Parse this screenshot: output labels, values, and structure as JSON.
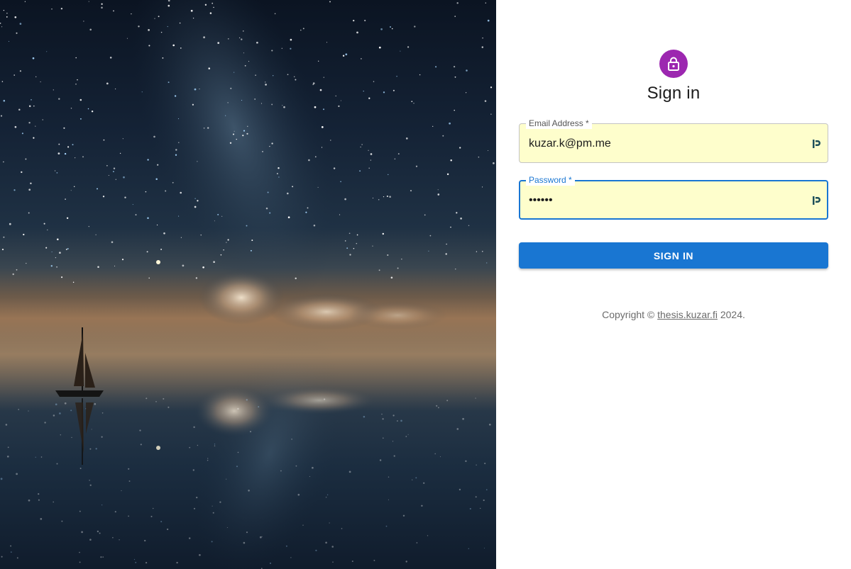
{
  "hero": {
    "image_name": "starry-night-sailboat-image"
  },
  "signin": {
    "icon": "lock-icon",
    "accent_color": "#9c27b0",
    "title": "Sign in",
    "email": {
      "label": "Email Address *",
      "value": "kuzar.k@pm.me"
    },
    "password": {
      "label": "Password *",
      "value": "••••••"
    },
    "button_label": "SIGN IN",
    "button_color": "#1976d2",
    "autofill_bg": "#fefecc"
  },
  "footer": {
    "prefix": "Copyright © ",
    "link_text": "thesis.kuzar.fi",
    "suffix": " 2024."
  }
}
